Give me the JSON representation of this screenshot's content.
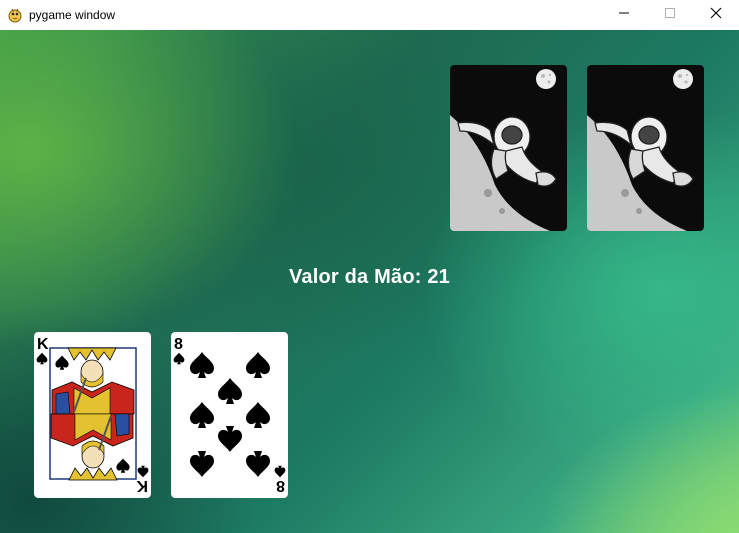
{
  "window": {
    "title": "pygame window",
    "icon": "pygame-snake-icon",
    "controls": [
      "minimize-icon",
      "maximize-icon",
      "close-icon"
    ]
  },
  "game": {
    "hand_value_text": "Valor da Mão: 21",
    "dealer_cards": [
      {
        "face": "down",
        "back_design": "astronaut"
      },
      {
        "face": "down",
        "back_design": "astronaut"
      }
    ],
    "player_cards": [
      {
        "rank": "K",
        "suit": "spades"
      },
      {
        "rank": "8",
        "suit": "spades"
      }
    ],
    "colors": {
      "table_green": "#1f6a52",
      "highlight_green": "#79d07d",
      "text": "#ffffff"
    }
  }
}
